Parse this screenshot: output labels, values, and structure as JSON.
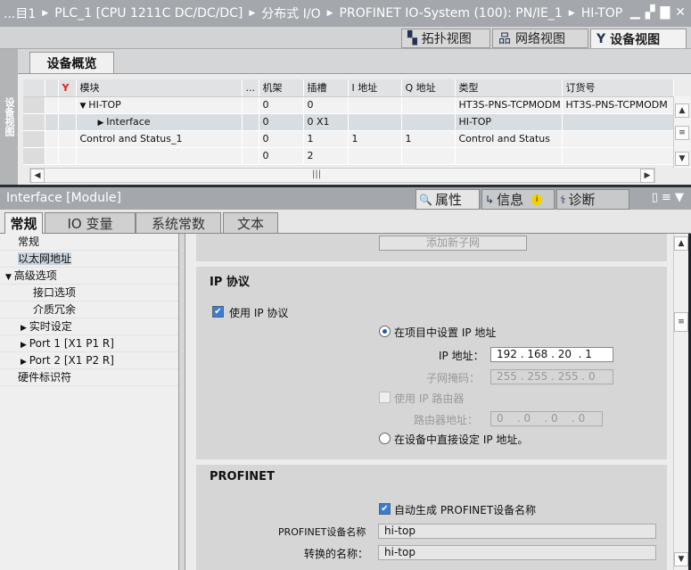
{
  "breadcrumb": [
    "...目1",
    "PLC_1 [CPU 1211C DC/DC/DC]",
    "分布式 I/O",
    "PROFINET IO-System (100): PN/IE_1",
    "HI-TOP"
  ],
  "views": {
    "topology": "拓扑视图",
    "network": "网络视图",
    "device": "设备视图"
  },
  "side_strip": "设备视图",
  "overview": {
    "tab": "设备概览",
    "headers": [
      "模块",
      "...",
      "机架",
      "插槽",
      "I 地址",
      "Q 地址",
      "类型",
      "订货号"
    ],
    "rows": [
      {
        "module": "HI-TOP",
        "rack": "0",
        "slot": "0",
        "i": "",
        "q": "",
        "type": "HT3S-PNS-TCPMODM",
        "order": "HT3S-PNS-TCPMODM"
      },
      {
        "module": "Interface",
        "rack": "0",
        "slot": "0 X1",
        "i": "",
        "q": "",
        "type": "HI-TOP",
        "order": ""
      },
      {
        "module": "Control and Status_1",
        "rack": "0",
        "slot": "1",
        "i": "1",
        "q": "1",
        "type": "Control and Status",
        "order": ""
      },
      {
        "module": "",
        "rack": "0",
        "slot": "2",
        "i": "",
        "q": "",
        "type": "",
        "order": ""
      }
    ]
  },
  "inspector": {
    "title": "Interface [Module]",
    "tabs": [
      "属性",
      "信息",
      "诊断"
    ],
    "subtabs": [
      "常规",
      "IO 变量",
      "系统常数",
      "文本"
    ],
    "nav": [
      "常规",
      "以太网地址",
      "高级选项",
      "接口选项",
      "介质冗余",
      "实时设定",
      "Port 1 [X1 P1 R]",
      "Port 2 [X1 P2 R]",
      "硬件标识符"
    ]
  },
  "content": {
    "add_subnet": "添加新子网",
    "ip_title": "IP 协议",
    "use_ip": "使用 IP 协议",
    "set_in_project": "在项目中设置 IP 地址",
    "ip_label": "IP 地址：",
    "ip_value": "192 . 168 . 20  . 1",
    "mask_label": "子网掩码：",
    "mask_value": "255 . 255 . 255 . 0",
    "use_router": "使用 IP 路由器",
    "router_label": "路由器地址：",
    "router_value": "0    . 0    . 0    . 0",
    "set_in_device": "在设备中直接设定 IP 地址。",
    "profinet_title": "PROFINET",
    "auto_name": "自动生成 PROFINET设备名称",
    "name_label": "PROFINET设备名称",
    "name_value": "hi-top",
    "conv_label": "转换的名称：",
    "conv_value": "hi-top"
  }
}
